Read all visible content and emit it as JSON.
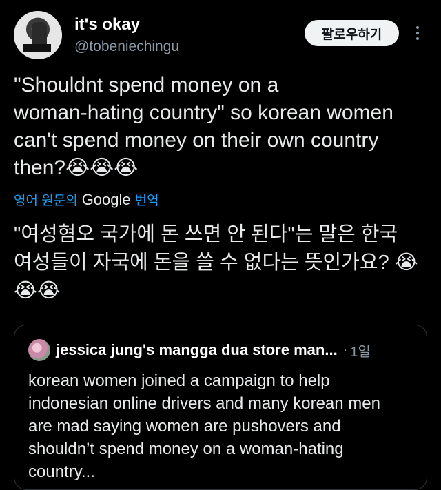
{
  "author": {
    "name": "it's okay",
    "handle": "@tobeniechingu"
  },
  "follow_button_label": "팔로우하기",
  "more_icon": "more-vertical-icon",
  "tweet": {
    "text": "\"Shouldnt spend money on a\nwoman-hating country\" so korean women\ncan't spend money on their own country\nthen?😭😭😭",
    "translated_by_prefix": "영어 원문의",
    "translated_by_brand": "Google",
    "translated_by_suffix": "번역",
    "translated_text": "\"여성혐오 국가에 돈 쓰면 안 된다\"는 말은 한국\n여성들이 자국에 돈을 쓸 수 없다는 뜻인가요? 😭\n😭😭"
  },
  "quote": {
    "name": "jessica jung's mangga dua store man...",
    "separator": "·",
    "time": "1일",
    "text": "korean women joined a campaign to help\nindonesian online drivers and many korean men\nare mad saying women are pushovers and\nshouldn’t spend money on a woman-hating\ncountry..."
  }
}
